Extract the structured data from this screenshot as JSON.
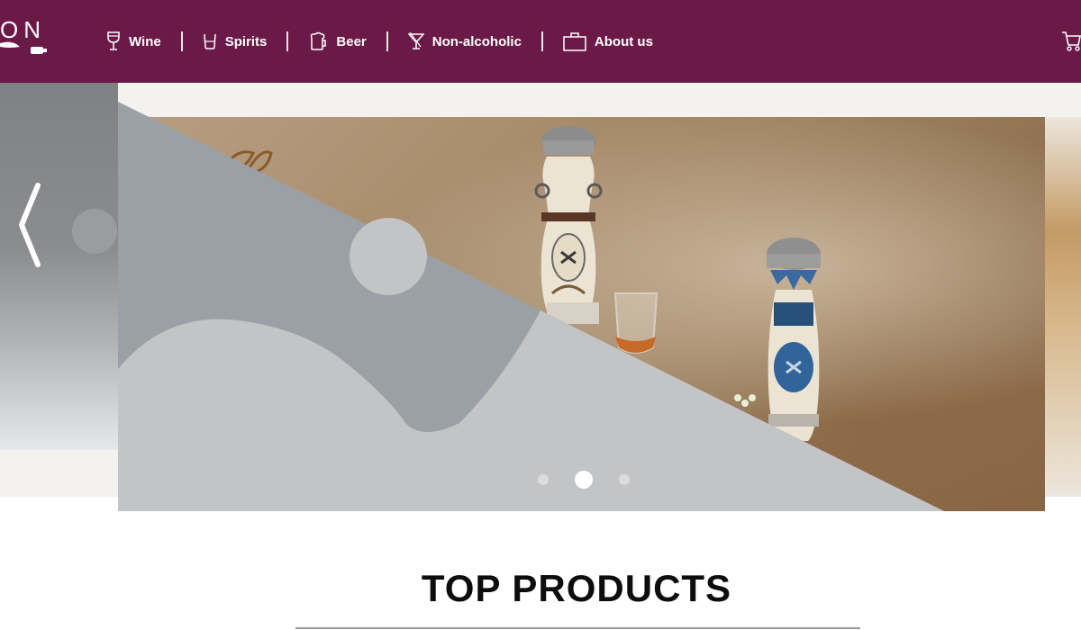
{
  "header": {
    "logo_text": "ON",
    "nav": [
      {
        "label": "Wine",
        "icon": "wine-glass-icon"
      },
      {
        "label": "Spirits",
        "icon": "spirits-glass-icon"
      },
      {
        "label": "Beer",
        "icon": "beer-mug-icon"
      },
      {
        "label": "Non-alcoholic",
        "icon": "cocktail-glass-icon"
      },
      {
        "label": "About us",
        "icon": "briefcase-icon"
      }
    ],
    "cart_icon": "cart-icon"
  },
  "carousel": {
    "prev_icon": "chevron-left-icon",
    "dots": 3,
    "active_dot": 2
  },
  "main": {
    "section_title": "TOP PRODUCTS"
  },
  "colors": {
    "brand": "#6b1a48",
    "overlay_dark": "#9aa0a6",
    "overlay_light": "#c3c4c6"
  }
}
